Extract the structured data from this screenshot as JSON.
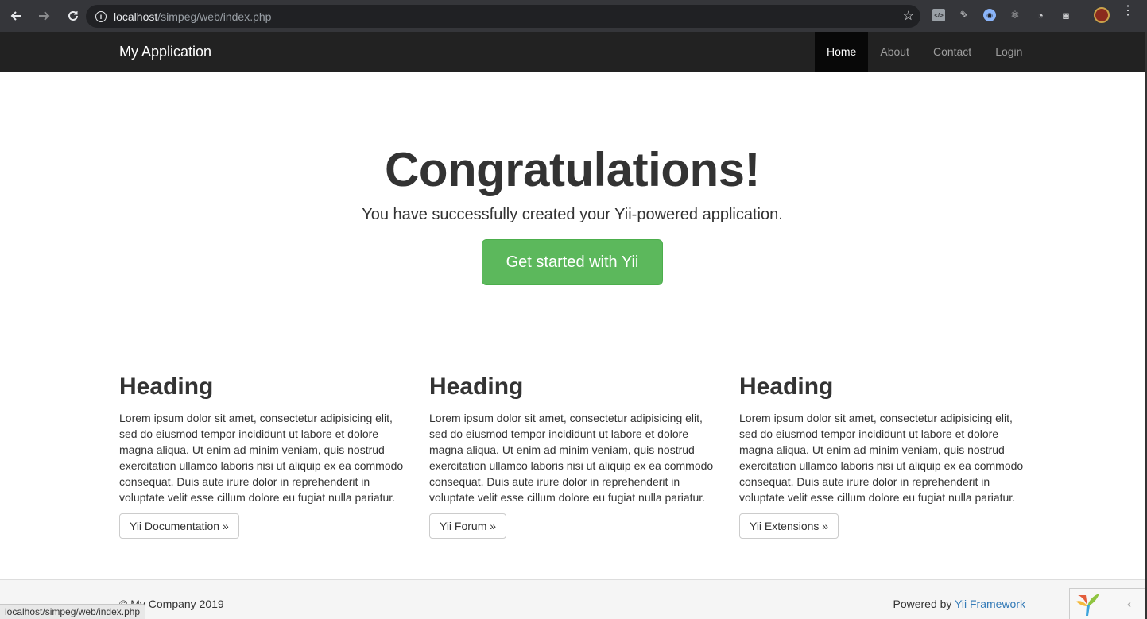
{
  "browser": {
    "url_host": "localhost",
    "url_path": "/simpeg/web/index.php",
    "status_url": "localhost/simpeg/web/index.php"
  },
  "navbar": {
    "brand": "My Application",
    "links": [
      {
        "label": "Home",
        "active": true
      },
      {
        "label": "About",
        "active": false
      },
      {
        "label": "Contact",
        "active": false
      },
      {
        "label": "Login",
        "active": false
      }
    ]
  },
  "jumbotron": {
    "title": "Congratulations!",
    "lead": "You have successfully created your Yii-powered application.",
    "button": "Get started with Yii"
  },
  "columns": [
    {
      "heading": "Heading",
      "body": "Lorem ipsum dolor sit amet, consectetur adipisicing elit, sed do eiusmod tempor incididunt ut labore et dolore magna aliqua. Ut enim ad minim veniam, quis nostrud exercitation ullamco laboris nisi ut aliquip ex ea commodo consequat. Duis aute irure dolor in reprehenderit in voluptate velit esse cillum dolore eu fugiat nulla pariatur.",
      "button": "Yii Documentation »"
    },
    {
      "heading": "Heading",
      "body": "Lorem ipsum dolor sit amet, consectetur adipisicing elit, sed do eiusmod tempor incididunt ut labore et dolore magna aliqua. Ut enim ad minim veniam, quis nostrud exercitation ullamco laboris nisi ut aliquip ex ea commodo consequat. Duis aute irure dolor in reprehenderit in voluptate velit esse cillum dolore eu fugiat nulla pariatur.",
      "button": "Yii Forum »"
    },
    {
      "heading": "Heading",
      "body": "Lorem ipsum dolor sit amet, consectetur adipisicing elit, sed do eiusmod tempor incididunt ut labore et dolore magna aliqua. Ut enim ad minim veniam, quis nostrud exercitation ullamco laboris nisi ut aliquip ex ea commodo consequat. Duis aute irure dolor in reprehenderit in voluptate velit esse cillum dolore eu fugiat nulla pariatur.",
      "button": "Yii Extensions »"
    }
  ],
  "footer": {
    "copyright": "© My Company 2019",
    "powered_prefix": "Powered by ",
    "powered_link": "Yii Framework"
  },
  "colors": {
    "navbar_bg": "#222222",
    "success": "#5cb85c",
    "link": "#337ab7"
  },
  "icons": [
    "back-arrow-icon",
    "forward-arrow-icon",
    "reload-icon",
    "info-icon",
    "star-icon",
    "chevron-left-icon"
  ]
}
